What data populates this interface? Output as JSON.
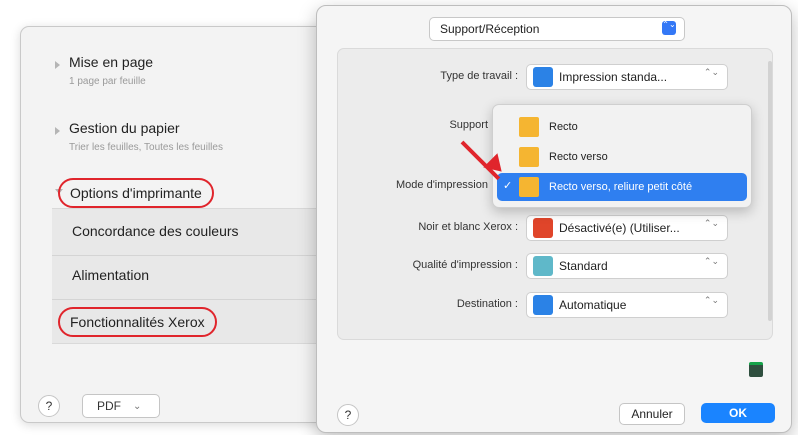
{
  "left_panel": {
    "sections": [
      {
        "title": "Mise en page",
        "subtitle": "1 page par feuille"
      },
      {
        "title": "Gestion du papier",
        "subtitle": "Trier les feuilles, Toutes les feuilles"
      }
    ],
    "options_title": "Options d'imprimante",
    "features": [
      "Concordance des couleurs",
      "Alimentation"
    ],
    "xerox_title": "Fonctionnalités Xerox",
    "help": "?",
    "pdf_label": "PDF",
    "pdf_arrow": "⌄"
  },
  "dialog": {
    "top_select": "Support/Réception",
    "stepper_glyph": "⌃⌄",
    "fields": [
      {
        "label": "Type de travail :",
        "value": "Impression standa...",
        "icon_color": "#2b82e6"
      },
      {
        "label": "Support",
        "value": "",
        "icon_color": ""
      },
      {
        "label": "Mode d'impression",
        "value": "",
        "icon_color": ""
      },
      {
        "label": "Noir et blanc Xerox :",
        "value": "Désactivé(e) (Utiliser...",
        "icon_color": "#e0452a"
      },
      {
        "label": "Qualité d'impression :",
        "value": "Standard",
        "icon_color": "#5fb8c9"
      },
      {
        "label": "Destination :",
        "value": "Automatique",
        "icon_color": "#2b82e6"
      }
    ],
    "help": "?",
    "cancel": "Annuler",
    "ok": "OK"
  },
  "menu": {
    "items": [
      {
        "label": "Recto",
        "selected": false,
        "icon_color": "#f5b531"
      },
      {
        "label": "Recto verso",
        "selected": false,
        "icon_color": "#f5b531"
      },
      {
        "label": "Recto verso, reliure petit côté",
        "selected": true,
        "icon_color": "#f5b531"
      }
    ],
    "check": "✓"
  },
  "colors": {
    "annotation_red": "#e0252c",
    "accent_blue": "#1a84ff"
  }
}
